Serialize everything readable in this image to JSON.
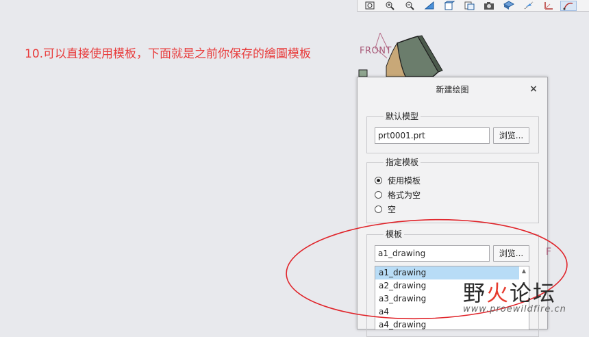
{
  "annotation": "10.可以直接使用模板，下面就是之前你保存的繪圖模板",
  "view_label": "FRONT",
  "stray_label": "F",
  "toolbar": {
    "icons": [
      "zoom-fit-icon",
      "zoom-in-icon",
      "zoom-out-icon",
      "plane-display-icon",
      "view-orient-icon",
      "saved-views-icon",
      "camera-icon",
      "shading-icon",
      "datum-display-icon",
      "sketch-icon"
    ]
  },
  "dialog": {
    "title": "新建绘图",
    "close": "×",
    "default_model": {
      "legend": "默认模型",
      "value": "prt0001.prt",
      "browse": "浏览..."
    },
    "template_spec": {
      "legend": "指定模板",
      "options": [
        "使用模板",
        "格式为空",
        "空"
      ],
      "selected": "使用模板"
    },
    "template": {
      "legend": "模板",
      "value": "a1_drawing",
      "browse": "浏览...",
      "list": [
        "a1_drawing",
        "a2_drawing",
        "a3_drawing",
        "a4",
        "a4_drawing"
      ],
      "selected": "a1_drawing"
    }
  },
  "watermark": {
    "part1": "野",
    "part2": "火",
    "part3": "论坛",
    "url": "www.proewildfire.cn"
  },
  "colors": {
    "annotation": "#e83a3a",
    "highlight_ellipse": "#e0242a",
    "selection": "#b8dcf6",
    "background": "#e8e9ed"
  }
}
